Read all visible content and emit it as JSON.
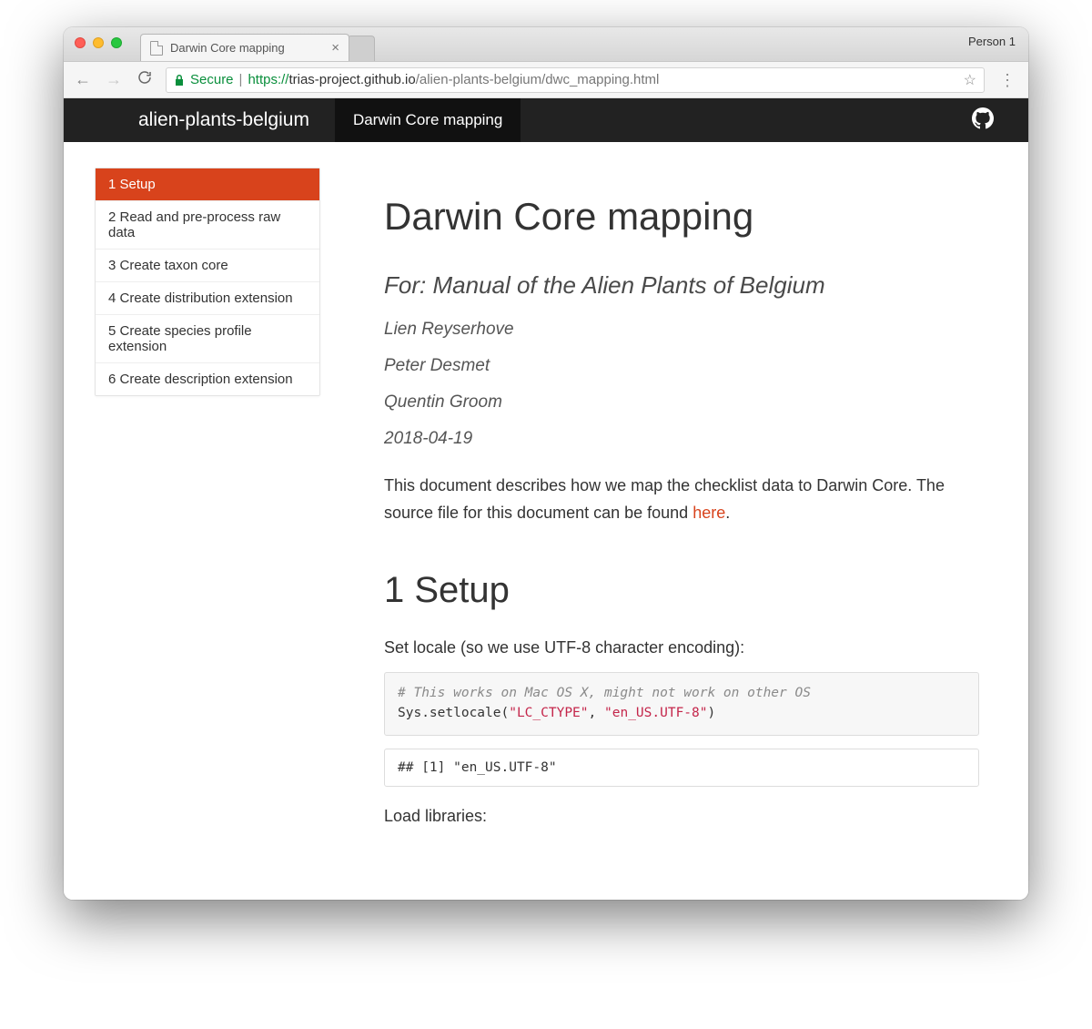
{
  "window": {
    "tab_title": "Darwin Core mapping",
    "profile": "Person 1"
  },
  "addressbar": {
    "secure_label": "Secure",
    "url_proto": "https://",
    "url_host": "trias-project.github.io",
    "url_path": "/alien-plants-belgium/dwc_mapping.html"
  },
  "page_nav": {
    "brand": "alien-plants-belgium",
    "item": "Darwin Core mapping"
  },
  "toc": {
    "items": [
      {
        "label": "1 Setup",
        "active": true
      },
      {
        "label": "2 Read and pre-process raw data",
        "active": false
      },
      {
        "label": "3 Create taxon core",
        "active": false
      },
      {
        "label": "4 Create distribution extension",
        "active": false
      },
      {
        "label": "5 Create species profile extension",
        "active": false
      },
      {
        "label": "6 Create description extension",
        "active": false
      }
    ]
  },
  "main": {
    "title": "Darwin Core mapping",
    "subtitle": "For: Manual of the Alien Plants of Belgium",
    "authors": [
      "Lien Reyserhove",
      "Peter Desmet",
      "Quentin Groom"
    ],
    "date": "2018-04-19",
    "intro_prefix": "This document describes how we map the checklist data to Darwin Core. The source file for this document can be found ",
    "intro_link": "here",
    "intro_suffix": ".",
    "section1_heading": "1 Setup",
    "section1_p1": "Set locale (so we use UTF-8 character encoding):",
    "code1": {
      "comment": "# This works on Mac OS X, might not work on other OS",
      "call_pre": "Sys.setlocale(",
      "arg1": "\"LC_CTYPE\"",
      "sep": ", ",
      "arg2": "\"en_US.UTF-8\"",
      "call_post": ")"
    },
    "output1": "## [1] \"en_US.UTF-8\"",
    "section1_p2": "Load libraries:"
  }
}
